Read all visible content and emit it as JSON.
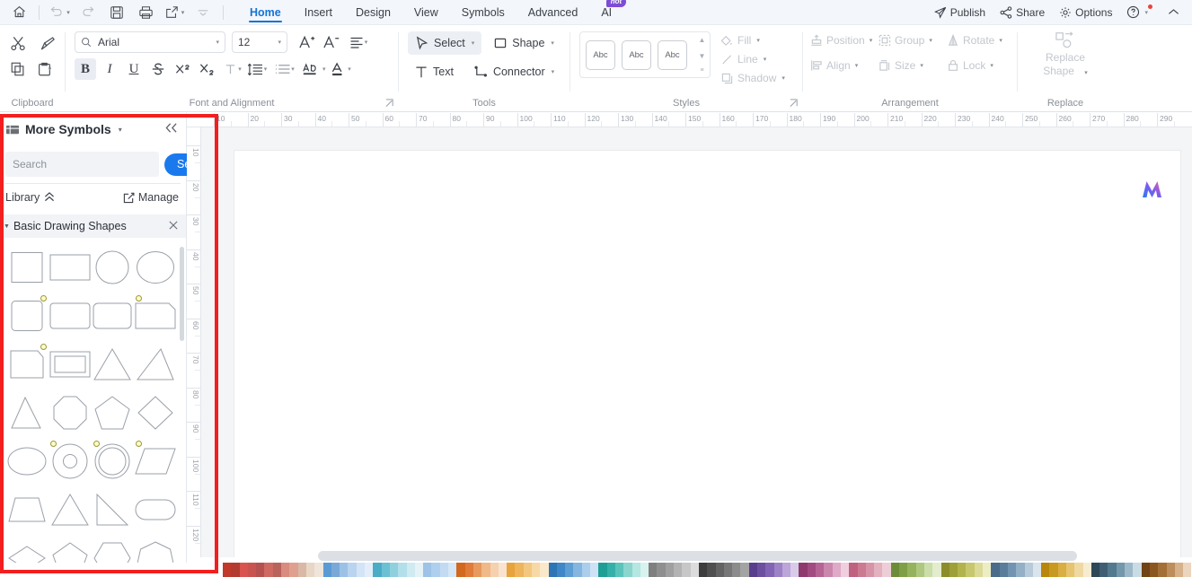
{
  "menubar": {
    "quick_icons": [
      "home-icon",
      "undo-icon",
      "redo-icon",
      "save-icon",
      "print-icon",
      "export-icon",
      "more-icon"
    ],
    "items": [
      {
        "label": "Home",
        "active": true,
        "badge": null
      },
      {
        "label": "Insert",
        "active": false,
        "badge": null
      },
      {
        "label": "Design",
        "active": false,
        "badge": null
      },
      {
        "label": "View",
        "active": false,
        "badge": null
      },
      {
        "label": "Symbols",
        "active": false,
        "badge": null
      },
      {
        "label": "Advanced",
        "active": false,
        "badge": null
      },
      {
        "label": "AI",
        "active": false,
        "badge": "hot"
      }
    ],
    "right": [
      {
        "label": "Publish",
        "icon": "publish-icon"
      },
      {
        "label": "Share",
        "icon": "share-icon"
      },
      {
        "label": "Options",
        "icon": "gear-icon"
      }
    ],
    "help_icon": "help-icon",
    "collapse_icon": "chevron-up-icon"
  },
  "ribbon": {
    "clipboard": {
      "label": "Clipboard",
      "buttons": [
        {
          "name": "cut-button",
          "icon": "scissors-icon"
        },
        {
          "name": "format-painter-button",
          "icon": "paint-brush-icon"
        },
        {
          "name": "copy-button",
          "icon": "copy-icon"
        },
        {
          "name": "paste-button",
          "icon": "paste-icon"
        }
      ]
    },
    "font": {
      "label": "Font and Alignment",
      "font_family": "Arial",
      "font_size": "12",
      "buttons": [
        {
          "name": "increase-font-button",
          "label": "A+"
        },
        {
          "name": "decrease-font-button",
          "label": "A-"
        },
        {
          "name": "bold-button",
          "label": "B",
          "active": true
        },
        {
          "name": "italic-button",
          "label": "I"
        },
        {
          "name": "underline-button",
          "label": "U"
        },
        {
          "name": "strikethrough-button",
          "label": "S"
        },
        {
          "name": "superscript-button",
          "label": "X2"
        },
        {
          "name": "subscript-button",
          "label": "X2"
        }
      ]
    },
    "tools": {
      "label": "Tools",
      "items": [
        {
          "label": "Select",
          "icon": "cursor-icon",
          "active": true,
          "caret": true
        },
        {
          "label": "Shape",
          "icon": "square-icon",
          "active": false,
          "caret": true
        },
        {
          "label": "Text",
          "icon": "text-icon",
          "active": false,
          "caret": false
        },
        {
          "label": "Connector",
          "icon": "connector-icon",
          "active": false,
          "caret": true
        }
      ]
    },
    "styles": {
      "label": "Styles",
      "thumbnails": [
        "Abc",
        "Abc",
        "Abc"
      ],
      "options": [
        {
          "label": "Fill",
          "icon": "fill-icon",
          "disabled": true
        },
        {
          "label": "Line",
          "icon": "line-icon",
          "disabled": true
        },
        {
          "label": "Shadow",
          "icon": "shadow-icon",
          "disabled": true
        }
      ]
    },
    "arrangement": {
      "label": "Arrangement",
      "items": [
        {
          "label": "Position",
          "icon": "position-icon",
          "disabled": true
        },
        {
          "label": "Group",
          "icon": "group-icon",
          "disabled": true
        },
        {
          "label": "Rotate",
          "icon": "rotate-icon",
          "disabled": true
        },
        {
          "label": "Align",
          "icon": "align-icon",
          "disabled": true
        },
        {
          "label": "Size",
          "icon": "size-icon",
          "disabled": true
        },
        {
          "label": "Lock",
          "icon": "lock-icon",
          "disabled": true
        }
      ]
    },
    "replace": {
      "label": "Replace",
      "button_line1": "Replace",
      "button_line2": "Shape",
      "icon": "replace-shape-icon",
      "disabled": true
    }
  },
  "left_panel": {
    "title": "More Symbols",
    "collapse_icon": "double-chevron-left-icon",
    "search": {
      "placeholder": "Search",
      "value": "",
      "button_label": "Search"
    },
    "library": {
      "label": "Library",
      "collapse_icon": "chevron-up-double-icon",
      "manage_label": "Manage",
      "manage_icon": "edit-square-icon"
    },
    "section": {
      "title": "Basic Drawing Shapes",
      "close_icon": "close-icon",
      "expanded": true
    },
    "shapes": [
      {
        "name": "square",
        "adj": false
      },
      {
        "name": "rectangle",
        "adj": false
      },
      {
        "name": "circle",
        "adj": false
      },
      {
        "name": "ellipse-wide",
        "adj": false
      },
      {
        "name": "rounded-square",
        "adj": true
      },
      {
        "name": "rounded-rectangle",
        "adj": false
      },
      {
        "name": "rounded-rectangle-2",
        "adj": false
      },
      {
        "name": "one-corner-rounded-rect",
        "adj": true
      },
      {
        "name": "single-corner-snip-rect",
        "adj": true
      },
      {
        "name": "frame-rectangle",
        "adj": false
      },
      {
        "name": "triangle-isoceles",
        "adj": false
      },
      {
        "name": "triangle-scalene",
        "adj": false
      },
      {
        "name": "triangle-narrow",
        "adj": false
      },
      {
        "name": "octagon",
        "adj": false
      },
      {
        "name": "pentagon",
        "adj": false
      },
      {
        "name": "diamond",
        "adj": false
      },
      {
        "name": "ellipse",
        "adj": false
      },
      {
        "name": "donut",
        "adj": true
      },
      {
        "name": "concentric-circle",
        "adj": true
      },
      {
        "name": "parallelogram",
        "adj": true
      },
      {
        "name": "trapezoid",
        "adj": false
      },
      {
        "name": "triangle-equilateral",
        "adj": false
      },
      {
        "name": "right-triangle",
        "adj": false
      },
      {
        "name": "stadium-rounded",
        "adj": false
      },
      {
        "name": "rhombus-flat",
        "adj": false
      },
      {
        "name": "pentagon-2",
        "adj": false
      },
      {
        "name": "hexagon",
        "adj": false
      },
      {
        "name": "heptagon",
        "adj": false
      }
    ]
  },
  "rulers": {
    "horizontal_ticks": [
      10,
      20,
      30,
      40,
      50,
      60,
      70,
      80,
      90,
      100,
      110,
      120,
      130,
      140,
      150,
      160,
      170,
      180,
      190,
      200,
      210,
      220,
      230,
      240,
      250,
      260,
      270,
      280,
      290
    ],
    "vertical_ticks": [
      10,
      20,
      30,
      40,
      50,
      60,
      70,
      80,
      90,
      100,
      110,
      120
    ]
  },
  "canvas": {
    "watermark_icon": "gradient-m-logo"
  },
  "bottom": {
    "scrollbar": "horizontal-scrollbar",
    "palette_colors": [
      "#c0392b",
      "#b33a30",
      "#d9534f",
      "#c9544f",
      "#b5524f",
      "#cf6a63",
      "#b9635c",
      "#d98b80",
      "#e0a08f",
      "#d9b9a5",
      "#e8d7c6",
      "#efe5da",
      "#5b9bd5",
      "#7aa9d8",
      "#9bc2e6",
      "#b9d4ee",
      "#d3e4f6",
      "#e4eef9",
      "#4bacc6",
      "#6cc0d4",
      "#8fd0de",
      "#b2dfe9",
      "#cfeaf1",
      "#e5f3f7",
      "#9dc3e6",
      "#aed0ee",
      "#c2dbf2",
      "#d6e7f7",
      "#d2691e",
      "#e07b39",
      "#e89a5c",
      "#f0b987",
      "#f5d1b0",
      "#f9e3d0",
      "#e8a33d",
      "#eeb55c",
      "#f3c77f",
      "#f7d9a6",
      "#fae8cb",
      "#2e75b6",
      "#3f87c7",
      "#5d9ed4",
      "#84b6e0",
      "#abceec",
      "#cfe2f5",
      "#1f9e96",
      "#35b0a8",
      "#5cc3bb",
      "#8ad6cf",
      "#b5e6e1",
      "#d8f2ef",
      "#7f7f7f",
      "#8f8f8f",
      "#a0a0a0",
      "#b3b3b3",
      "#c7c7c7",
      "#dcdcdc",
      "#3d3d3d",
      "#4f4f4f",
      "#636363",
      "#777777",
      "#8c8c8c",
      "#a3a3a3",
      "#5a3e8e",
      "#6d4fa0",
      "#8364b4",
      "#9d82c6",
      "#bba5d9",
      "#d7cbe9",
      "#8e3a6e",
      "#a24b82",
      "#b66496",
      "#cb86ae",
      "#dfaac7",
      "#efcede",
      "#c0627f",
      "#cb7a92",
      "#d794a8",
      "#e3b1bf",
      "#eeced6",
      "#6d8c3a",
      "#7f9f47",
      "#95b35c",
      "#afc87f",
      "#cbdda8",
      "#e3eccd",
      "#8c8c2a",
      "#9f9f38",
      "#b3b34d",
      "#c7c76d",
      "#dbdb97",
      "#ededc4",
      "#4a6b8a",
      "#5b7d9c",
      "#7294b0",
      "#93b0c6",
      "#b7cbdb",
      "#d9e4ec",
      "#b8860b",
      "#c99a21",
      "#d9ae42",
      "#e6c470",
      "#f0d9a1",
      "#f8ecd0",
      "#2f4858",
      "#3f5e72",
      "#53798f",
      "#7397ab",
      "#9db9c9",
      "#c9dbe4",
      "#704214",
      "#8a5721",
      "#a36f36",
      "#bd8d5b",
      "#d6b189",
      "#ecd5bd"
    ]
  }
}
